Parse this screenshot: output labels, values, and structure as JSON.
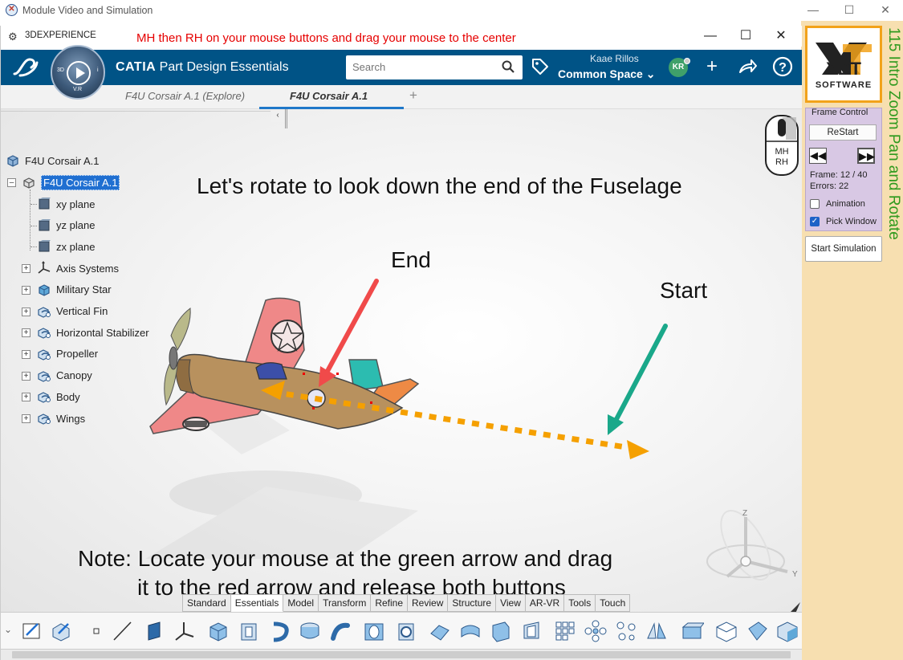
{
  "outer_window": {
    "title": "Module Video and Simulation",
    "min": "—",
    "max": "☐",
    "close": "✕"
  },
  "app_window": {
    "title": "3DEXPERIENCE",
    "instruction": "MH then RH on your mouse buttons and drag your mouse to the center",
    "min": "—",
    "max": "☐",
    "close": "✕"
  },
  "top_bar": {
    "app_name_bold": "CATIA",
    "app_name_rest": " Part Design Essentials",
    "search_placeholder": "Search",
    "user_name": "Kaae Rillos",
    "space": "Common Space",
    "avatar_initials": "KR",
    "compass": {
      "left": "3D",
      "right": "i",
      "bottom": "V.R"
    }
  },
  "tabs": [
    {
      "label": "F4U Corsair A.1 (Explore)"
    },
    {
      "label": "F4U Corsair A.1"
    }
  ],
  "tab_add": "+",
  "tree": {
    "root": "F4U Corsair A.1",
    "part": "F4U Corsair A.1",
    "items": [
      {
        "label": "xy plane",
        "icon": "plane-icon"
      },
      {
        "label": "yz plane",
        "icon": "plane-icon"
      },
      {
        "label": "zx plane",
        "icon": "plane-icon"
      },
      {
        "label": "Axis Systems",
        "icon": "axis-icon"
      },
      {
        "label": "Military Star",
        "icon": "body-icon"
      },
      {
        "label": "Vertical Fin",
        "icon": "geometric-set-icon"
      },
      {
        "label": "Horizontal Stabilizer",
        "icon": "geometric-set-icon"
      },
      {
        "label": "Propeller",
        "icon": "geometric-set-icon"
      },
      {
        "label": "Canopy",
        "icon": "geometric-set-icon"
      },
      {
        "label": "Body",
        "icon": "geometric-set-icon"
      },
      {
        "label": "Wings",
        "icon": "geometric-set-icon"
      }
    ]
  },
  "annotations": {
    "heading": "Let's rotate to look down the end of the Fuselage",
    "end_label": "End",
    "start_label": "Start",
    "note_line1": "Note: Locate your mouse at the green arrow and drag",
    "note_line2": "it to the red arrow and release both buttons"
  },
  "mouse_hint": {
    "line1": "MH",
    "line2": "RH"
  },
  "axes": {
    "z": "Z",
    "y": "Y"
  },
  "action_tabs": [
    {
      "label": "Standard"
    },
    {
      "label": "Essentials"
    },
    {
      "label": "Model"
    },
    {
      "label": "Transform"
    },
    {
      "label": "Refine"
    },
    {
      "label": "Review"
    },
    {
      "label": "Structure"
    },
    {
      "label": "View"
    },
    {
      "label": "AR-VR"
    },
    {
      "label": "Tools"
    },
    {
      "label": "Touch"
    }
  ],
  "active_action_tab": "Essentials",
  "right_panel": {
    "logo_line1": "XDT",
    "logo_line2": "SOFTWARE",
    "frame_control_label": "Frame Control",
    "restart_label": "ReStart",
    "prev_label": "◀◀",
    "next_label": "▶▶",
    "frame_text": "Frame: 12 / 40",
    "errors_text": "Errors: 22",
    "animation_label": "Animation",
    "animation_checked": false,
    "pick_window_label": "Pick Window",
    "pick_window_checked": true,
    "start_simulation_label": "Start Simulation",
    "lesson_title": "115 Intro Zoom Pan and Rotate"
  },
  "colors": {
    "brand_blue": "#005386",
    "instruction_red": "#e60000",
    "lesson_green": "#2f9a1e",
    "panel_bg": "#f7dfb0",
    "frame_box_bg": "#d8c8e4",
    "arrow_red": "#f04a4a",
    "arrow_green": "#1aa88a",
    "arrow_orange": "#f5a000"
  }
}
